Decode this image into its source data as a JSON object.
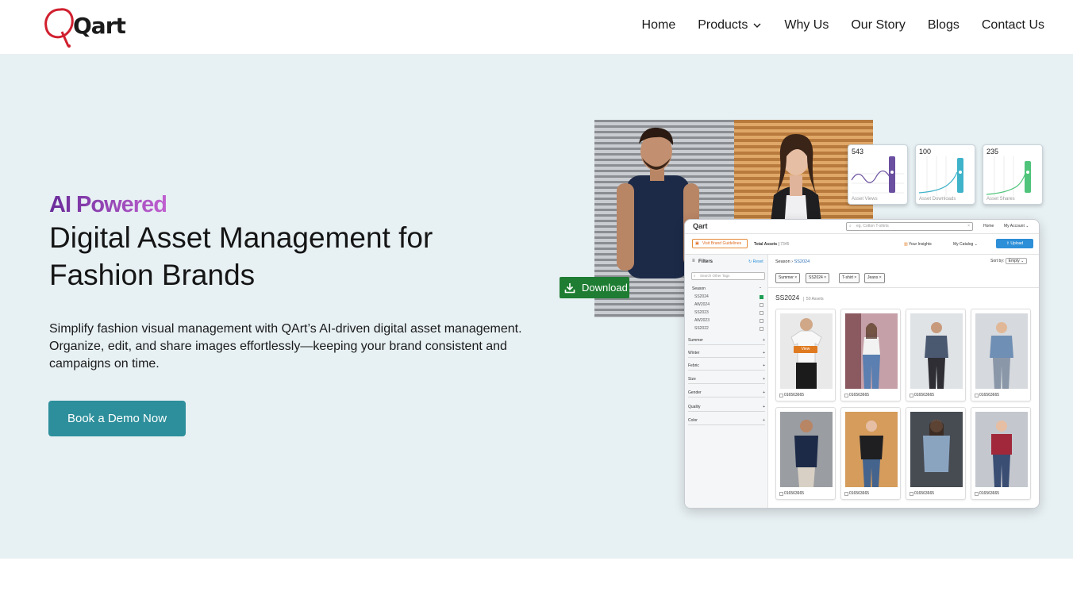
{
  "header": {
    "logo_text": "Qart",
    "nav": [
      {
        "label": "Home"
      },
      {
        "label": "Products",
        "has_dropdown": true
      },
      {
        "label": "Why Us"
      },
      {
        "label": "Our Story"
      },
      {
        "label": "Blogs"
      },
      {
        "label": "Contact Us"
      }
    ]
  },
  "hero": {
    "eyebrow": "AI Powered",
    "headline": "Digital Asset Management for Fashion Brands",
    "subtext": "Simplify fashion visual management with QArt’s AI-driven digital asset management. Organize, edit, and share images effortlessly—keeping your brand consistent and campaigns on time.",
    "cta_label": "Book a Demo Now",
    "download_label": "Download",
    "stats": [
      {
        "value": "543",
        "label": "Asset Views",
        "color": "#6b4fa0"
      },
      {
        "value": "100",
        "label": "Asset Downloads",
        "color": "#3fb3c9"
      },
      {
        "value": "235",
        "label": "Asset Shares",
        "color": "#4fc47a"
      }
    ]
  },
  "colors": {
    "hero_bg": "#e7f0f3",
    "cta": "#2c8f9b",
    "download": "#1e7d32",
    "logo_red": "#d0202f",
    "eyebrow_purple": "#7d3fb0"
  },
  "mockup": {
    "logo_text": "Qart",
    "search_placeholder": "eg. Cotton T-shirts",
    "home_label": "Home",
    "account_label": "My Account",
    "brand_guidelines_label": "Visit Brand Guidelines",
    "total_assets_label": "Total Assets",
    "total_assets_value": "7345",
    "insights_label": "Your Insights",
    "catalog_label": "My Catalog",
    "upload_label": "Upload",
    "filters_label": "Filters",
    "reset_label": "Reset",
    "tag_search_placeholder": "Search Other Tags",
    "season_group": "Season",
    "season_options": [
      "SS2024",
      "AW2024",
      "SS2023",
      "AW2023",
      "SS2022"
    ],
    "filter_groups": [
      "Summer",
      "Winter",
      "Febric",
      "Size",
      "Gender",
      "Quality",
      "Color"
    ],
    "breadcrumb_root": "Season",
    "breadcrumb_current": "SS2024",
    "sort_label": "Sort by:",
    "sort_value": "Empty",
    "chips": [
      "Summer",
      "SS2024",
      "T-shirt",
      "Jeans"
    ],
    "section_title": "SS2024",
    "section_count": "50 Assets",
    "view_label": "View",
    "asset_ids": [
      "016563665",
      "016563665",
      "016563665",
      "016563665",
      "016563665",
      "016563665",
      "016563665",
      "016563665"
    ]
  }
}
